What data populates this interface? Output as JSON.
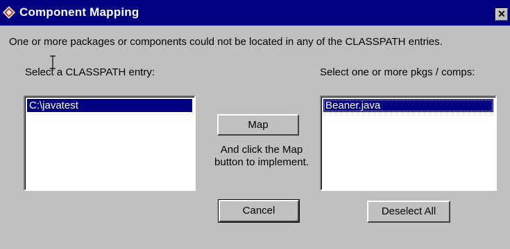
{
  "window": {
    "title": "Component Mapping",
    "close_glyph": "✕"
  },
  "message": "One or more  packages or components could not be located in any of the CLASSPATH entries.",
  "classpath": {
    "label": "Select a CLASSPATH entry:",
    "items": [
      "C:\\javatest"
    ]
  },
  "components": {
    "label": "Select one or more pkgs / comps:",
    "items": [
      "Beaner.java"
    ]
  },
  "buttons": {
    "map": "Map",
    "cancel": "Cancel",
    "deselect_all": "Deselect All"
  },
  "hint": "And click the Map button to implement.",
  "colors": {
    "titlebar": "#000080",
    "face": "#c0c0c0",
    "selection": "#000080"
  },
  "icons": {
    "app": "diamond-app-icon",
    "close": "close-icon",
    "cursor": "text-cursor-icon"
  }
}
